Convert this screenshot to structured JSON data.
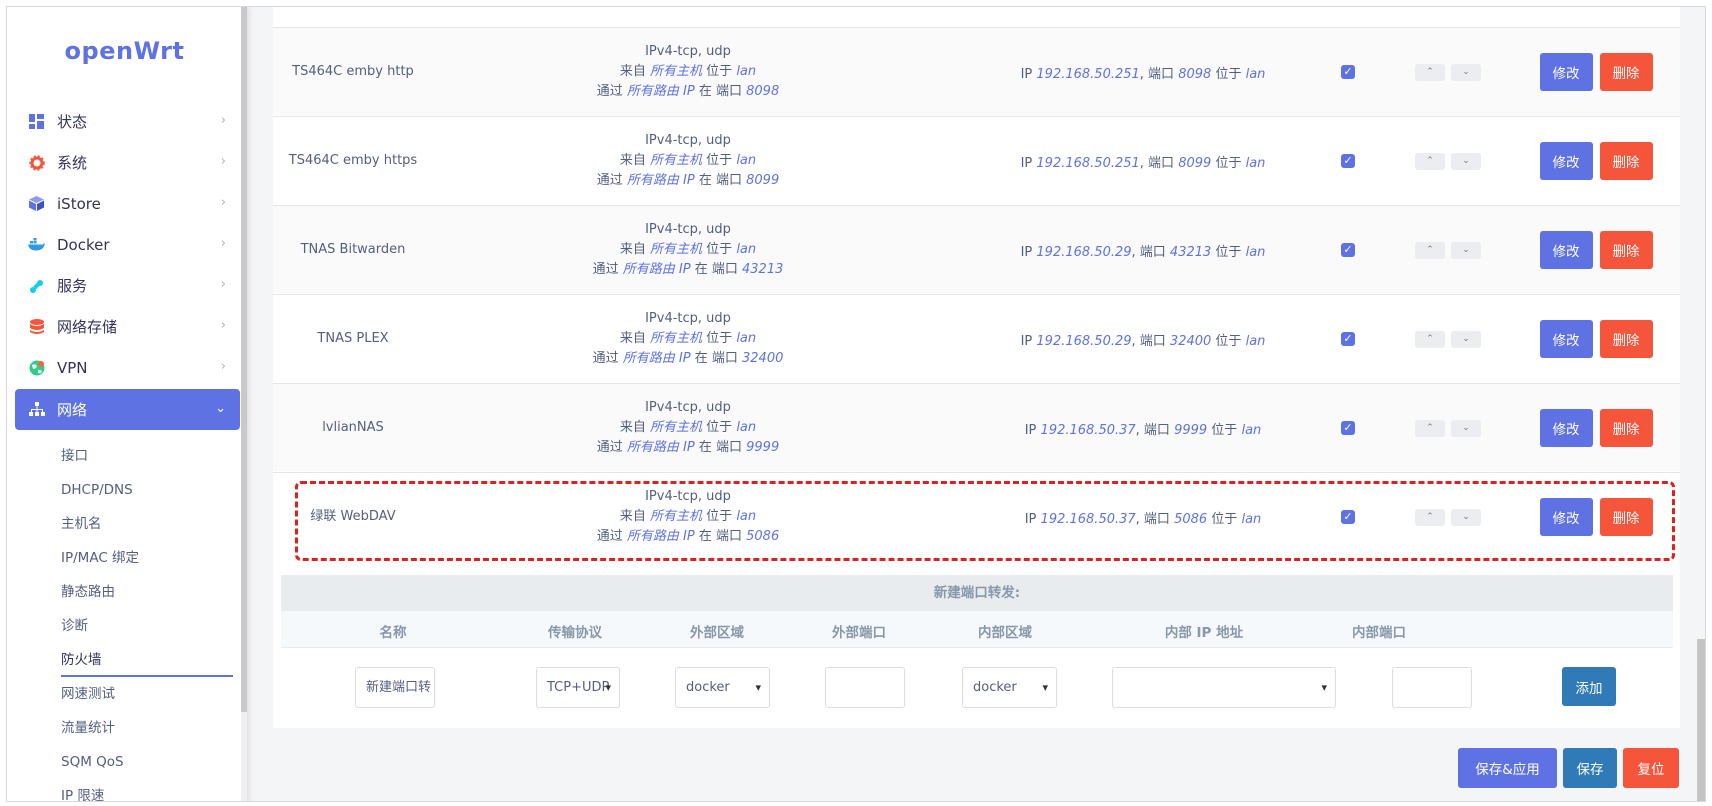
{
  "app": {
    "logo": "openWrt"
  },
  "sidebar": {
    "items": [
      {
        "label": "状态",
        "icon": "dashboard-icon",
        "color": "#5e72e4"
      },
      {
        "label": "系统",
        "icon": "gear-icon",
        "color": "#f5553b"
      },
      {
        "label": "iStore",
        "icon": "cube-icon",
        "color": "#5e72e4"
      },
      {
        "label": "Docker",
        "icon": "docker-icon",
        "color": "#2f9be0"
      },
      {
        "label": "服务",
        "icon": "puzzle-icon",
        "color": "#11cdef"
      },
      {
        "label": "网络存储",
        "icon": "database-icon",
        "color": "#f5553b"
      },
      {
        "label": "VPN",
        "icon": "globe-icon",
        "color": "#2dce89"
      },
      {
        "label": "网络",
        "icon": "sitemap-icon",
        "active": true
      }
    ],
    "subitems": [
      "接口",
      "DHCP/DNS",
      "主机名",
      "IP/MAC 绑定",
      "静态路由",
      "诊断",
      "防火墙",
      "网速测试",
      "流量统计",
      "SQM QoS",
      "IP 限速"
    ],
    "current_sub": "防火墙"
  },
  "rules": [
    {
      "name": "TS464C emby http",
      "proto": "IPv4-tcp, udp",
      "from_prefix": "来自",
      "src": "所有主机",
      "at": "位于",
      "src_zone": "lan",
      "via_prefix": "通过",
      "via": "所有路由 IP",
      "port_prefix": "在 端口",
      "ext_port": "8098",
      "ip_prefix": "IP",
      "dest_ip": "192.168.50.251",
      "port_label": ", 端口",
      "int_port": "8098",
      "dest_zone": "lan",
      "enabled": true
    },
    {
      "name": "TS464C emby https",
      "proto": "IPv4-tcp, udp",
      "from_prefix": "来自",
      "src": "所有主机",
      "at": "位于",
      "src_zone": "lan",
      "via_prefix": "通过",
      "via": "所有路由 IP",
      "port_prefix": "在 端口",
      "ext_port": "8099",
      "ip_prefix": "IP",
      "dest_ip": "192.168.50.251",
      "port_label": ", 端口",
      "int_port": "8099",
      "dest_zone": "lan",
      "enabled": true
    },
    {
      "name": "TNAS Bitwarden",
      "proto": "IPv4-tcp, udp",
      "from_prefix": "来自",
      "src": "所有主机",
      "at": "位于",
      "src_zone": "lan",
      "via_prefix": "通过",
      "via": "所有路由 IP",
      "port_prefix": "在 端口",
      "ext_port": "43213",
      "ip_prefix": "IP",
      "dest_ip": "192.168.50.29",
      "port_label": ", 端口",
      "int_port": "43213",
      "dest_zone": "lan",
      "enabled": true
    },
    {
      "name": "TNAS PLEX",
      "proto": "IPv4-tcp, udp",
      "from_prefix": "来自",
      "src": "所有主机",
      "at": "位于",
      "src_zone": "lan",
      "via_prefix": "通过",
      "via": "所有路由 IP",
      "port_prefix": "在 端口",
      "ext_port": "32400",
      "ip_prefix": "IP",
      "dest_ip": "192.168.50.29",
      "port_label": ", 端口",
      "int_port": "32400",
      "dest_zone": "lan",
      "enabled": true
    },
    {
      "name": "lvlianNAS",
      "proto": "IPv4-tcp, udp",
      "from_prefix": "来自",
      "src": "所有主机",
      "at": "位于",
      "src_zone": "lan",
      "via_prefix": "通过",
      "via": "所有路由 IP",
      "port_prefix": "在 端口",
      "ext_port": "9999",
      "ip_prefix": "IP",
      "dest_ip": "192.168.50.37",
      "port_label": ", 端口",
      "int_port": "9999",
      "dest_zone": "lan",
      "enabled": true
    },
    {
      "name": "绿联 WebDAV",
      "proto": "IPv4-tcp, udp",
      "from_prefix": "来自",
      "src": "所有主机",
      "at": "位于",
      "src_zone": "lan",
      "via_prefix": "通过",
      "via": "所有路由 IP",
      "port_prefix": "在 端口",
      "ext_port": "5086",
      "ip_prefix": "IP",
      "dest_ip": "192.168.50.37",
      "port_label": ", 端口",
      "int_port": "5086",
      "dest_zone": "lan",
      "enabled": true,
      "highlighted": true
    }
  ],
  "row_actions": {
    "edit": "修改",
    "delete": "删除",
    "up": "⌃",
    "down": "⌄"
  },
  "new_rule": {
    "title": "新建端口转发:",
    "headers": [
      "名称",
      "传输协议",
      "外部区域",
      "外部端口",
      "内部区域",
      "内部 IP 地址",
      "内部端口"
    ],
    "name_value": "新建端口转",
    "protocol": "TCP+UDP",
    "ext_zone": "docker",
    "ext_port": "",
    "int_zone": "docker",
    "int_ip": "",
    "int_port": "",
    "add_label": "添加"
  },
  "footer": {
    "save_apply": "保存&应用",
    "save": "保存",
    "reset": "复位"
  },
  "colors": {
    "primary": "#5e72e4",
    "danger": "#f5553b",
    "info": "#2f7ab7"
  }
}
